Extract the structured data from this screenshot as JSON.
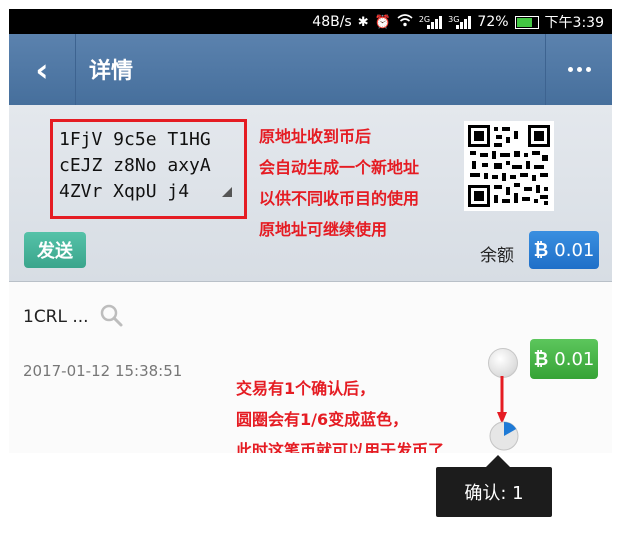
{
  "status_bar": {
    "speed": "48B/s",
    "net_2g": "2G",
    "net_3g": "3G",
    "battery": "72%",
    "time": "下午3:39"
  },
  "header": {
    "back_icon": "‹",
    "title": "详情",
    "more": "more-icon"
  },
  "address": {
    "lines": [
      "1FjV 9c5e T1HG",
      "cEJZ z8No axyA",
      "4ZVr XqpU j4"
    ]
  },
  "note_top": [
    "原地址收到币后",
    "会自动生成一个新地址",
    "以供不同收币目的使用",
    "原地址可继续使用"
  ],
  "send_label": "发送",
  "balance": {
    "label": "余额",
    "symbol": "₿",
    "value": "0.01"
  },
  "transaction": {
    "address": "1CRL ...",
    "date": "2017-01-12 15:38:51",
    "symbol": "₿",
    "amount": "0.01",
    "confirm_progress": 0.1667
  },
  "note_bottom": [
    "交易有1个确认后，",
    "圆圈会有1/6变成蓝色，",
    "此时这笔币就可以用于发币了"
  ],
  "tooltip": "确认: 1",
  "colors": {
    "accent_red": "#e51c23",
    "header_blue": "#4f77a5",
    "balance_blue": "#2a7fd6",
    "amount_green": "#43b043",
    "send_teal": "#45b39a"
  }
}
